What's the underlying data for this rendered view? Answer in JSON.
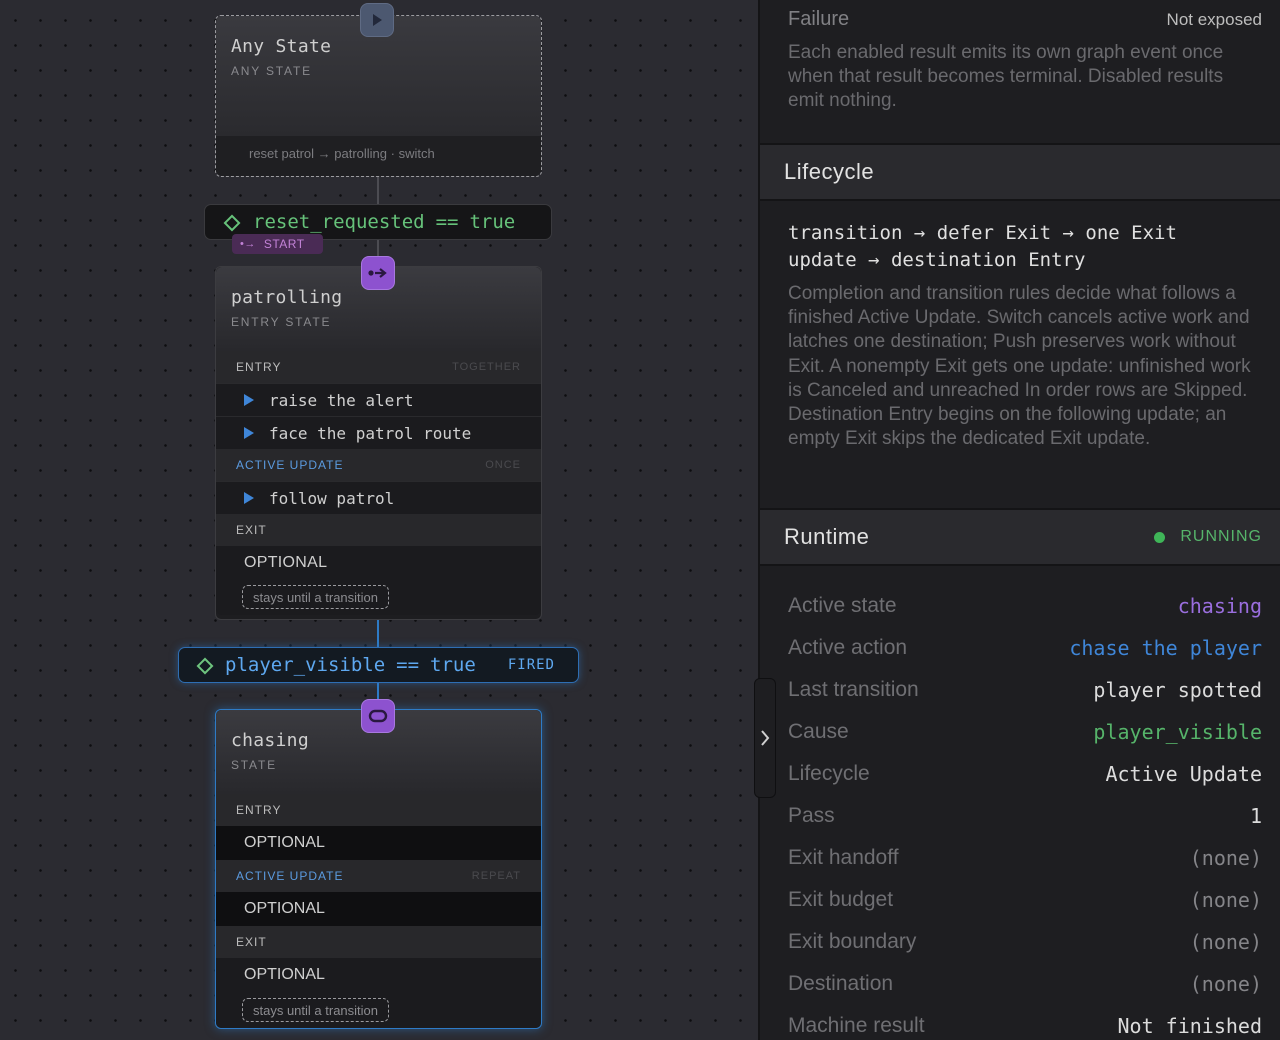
{
  "canvas": {
    "any_state": {
      "title": "Any State",
      "kind": "ANY STATE",
      "footer": "reset patrol → patrolling · switch"
    },
    "reset_condition": {
      "variable": "reset_requested",
      "op": "==",
      "value": "true"
    },
    "start_badge": "START",
    "patrolling": {
      "title": "patrolling",
      "kind": "ENTRY STATE",
      "entry": {
        "label": "ENTRY",
        "mode": "TOGETHER",
        "rows": [
          "raise the alert",
          "face the patrol route"
        ]
      },
      "active_update": {
        "label": "ACTIVE UPDATE",
        "mode": "ONCE",
        "rows": [
          "follow patrol"
        ]
      },
      "exit": {
        "label": "EXIT",
        "value": "OPTIONAL"
      },
      "note": "stays until a transition"
    },
    "player_condition": {
      "variable": "player_visible",
      "op": "==",
      "value": "true",
      "status": "FIRED"
    },
    "chasing": {
      "title": "chasing",
      "kind": "STATE",
      "entry": {
        "label": "ENTRY",
        "value": "OPTIONAL"
      },
      "active_update": {
        "label": "ACTIVE UPDATE",
        "mode": "REPEAT",
        "value": "OPTIONAL"
      },
      "exit": {
        "label": "EXIT",
        "value": "OPTIONAL"
      },
      "note": "stays until a transition"
    }
  },
  "panel": {
    "failure": {
      "label": "Failure",
      "value": "Not exposed",
      "description": "Each enabled result emits its own graph event once when that result becomes terminal. Disabled results emit nothing."
    },
    "lifecycle": {
      "title": "Lifecycle",
      "code_line1": "transition → defer Exit → one Exit",
      "code_line2": "update → destination Entry",
      "description": "Completion and transition rules decide what follows a finished Active Update. Switch cancels active work and latches one destination; Push preserves work without Exit. A nonempty Exit gets one update: unfinished work is Canceled and unreached In order rows are Skipped. Destination Entry begins on the following update; an empty Exit skips the dedicated Exit update."
    },
    "runtime": {
      "title": "Runtime",
      "status": "RUNNING",
      "status_color": "#3fb558",
      "rows": [
        {
          "label": "Active state",
          "value": "chasing"
        },
        {
          "label": "Active action",
          "value": "chase the player"
        },
        {
          "label": "Last transition",
          "value": "player spotted"
        },
        {
          "label": "Cause",
          "value": "player_visible"
        },
        {
          "label": "Lifecycle",
          "value": "Active Update"
        },
        {
          "label": "Pass",
          "value": "1"
        },
        {
          "label": "Exit handoff",
          "value": "(none)"
        },
        {
          "label": "Exit budget",
          "value": "(none)"
        },
        {
          "label": "Exit boundary",
          "value": "(none)"
        },
        {
          "label": "Destination",
          "value": "(none)"
        },
        {
          "label": "Machine result",
          "value": "Not finished"
        }
      ]
    }
  },
  "icons": {
    "play": "play-icon",
    "transition": "arrow-right-icon",
    "loop": "loop-icon",
    "collapse": "chevron-right-icon"
  }
}
